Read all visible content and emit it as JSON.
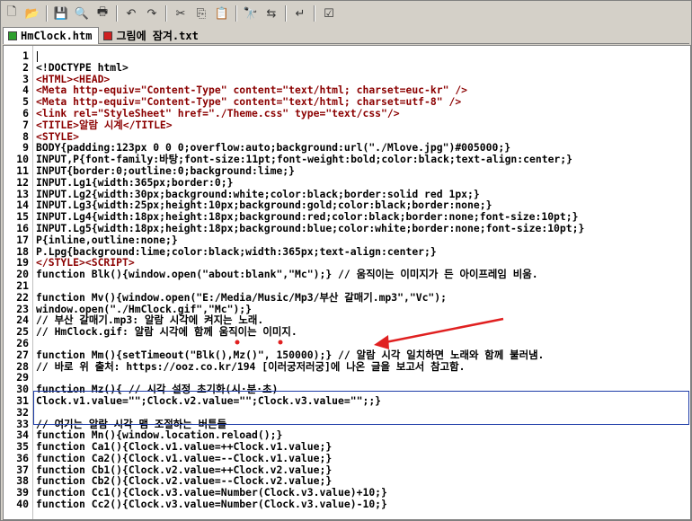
{
  "toolbar": {
    "buttons": [
      {
        "name": "new-file-icon",
        "glyph": "🗋"
      },
      {
        "name": "open-folder-icon",
        "glyph": "📂"
      },
      {
        "name": "save-icon",
        "glyph": "💾"
      },
      {
        "name": "print-preview-icon",
        "glyph": "🔍"
      },
      {
        "name": "print-icon",
        "glyph": "🖶"
      },
      {
        "name": "undo-icon",
        "glyph": "↶"
      },
      {
        "name": "redo-icon",
        "glyph": "↷"
      },
      {
        "name": "cut-icon",
        "glyph": "✂"
      },
      {
        "name": "copy-icon",
        "glyph": "⎘"
      },
      {
        "name": "paste-icon",
        "glyph": "📋"
      },
      {
        "name": "find-icon",
        "glyph": "🔭"
      },
      {
        "name": "replace-icon",
        "glyph": "⇆"
      },
      {
        "name": "word-wrap-icon",
        "glyph": "↵"
      },
      {
        "name": "checklist-icon",
        "glyph": "☑"
      }
    ]
  },
  "tabs": [
    {
      "label": "HmClock.htm",
      "color": "#2ea02e",
      "active": true
    },
    {
      "label": "그림에 잠겨.txt",
      "color": "#d02020",
      "active": false
    }
  ],
  "editor": {
    "lines": [
      {
        "n": "1",
        "text": ""
      },
      {
        "n": "2",
        "text": "<!DOCTYPE html>"
      },
      {
        "n": "3",
        "text": "<HTML><HEAD>"
      },
      {
        "n": "4",
        "text": "<Meta http-equiv=\"Content-Type\" content=\"text/html; charset=euc-kr\" />"
      },
      {
        "n": "5",
        "text": "<Meta http-equiv=\"Content-Type\" content=\"text/html; charset=utf-8\" />"
      },
      {
        "n": "6",
        "text": "<link rel=\"StyleSheet\" href=\"./Theme.css\" type=\"text/css\"/>"
      },
      {
        "n": "7",
        "text": "<TITLE>알람 시계</TITLE>"
      },
      {
        "n": "8",
        "text": "<STYLE>"
      },
      {
        "n": "9",
        "text": "BODY{padding:123px 0 0 0;overflow:auto;background:url(\"./Mlove.jpg\")#005000;}"
      },
      {
        "n": "10",
        "text": "INPUT,P{font-family:바탕;font-size:11pt;font-weight:bold;color:black;text-align:center;}"
      },
      {
        "n": "11",
        "text": "INPUT{border:0;outline:0;background:lime;}"
      },
      {
        "n": "12",
        "text": "INPUT.Lg1{width:365px;border:0;}"
      },
      {
        "n": "13",
        "text": "INPUT.Lg2{width:30px;background:white;color:black;border:solid red 1px;}"
      },
      {
        "n": "14",
        "text": "INPUT.Lg3{width:25px;height:10px;background:gold;color:black;border:none;}"
      },
      {
        "n": "15",
        "text": "INPUT.Lg4{width:18px;height:18px;background:red;color:black;border:none;font-size:10pt;}"
      },
      {
        "n": "16",
        "text": "INPUT.Lg5{width:18px;height:18px;background:blue;color:white;border:none;font-size:10pt;}"
      },
      {
        "n": "17",
        "text": "P{inline,outline:none;}"
      },
      {
        "n": "18",
        "text": "P.Lpg{background:lime;color:black;width:365px;text-align:center;}"
      },
      {
        "n": "19",
        "text": "</STYLE><SCRIPT>"
      },
      {
        "n": "20",
        "text": "function Blk(){window.open(\"about:blank\",\"Mc\");} // 움직이는 이미지가 든 아이프레임 비움."
      },
      {
        "n": "21",
        "text": ""
      },
      {
        "n": "22",
        "text": "function Mv(){window.open(\"E:/Media/Music/Mp3/부산 갈매기.mp3\",\"Vc\");"
      },
      {
        "n": "23",
        "text": "window.open(\"./HmClock.gif\",\"Mc\");}"
      },
      {
        "n": "24",
        "text": "// 부산 갈매기.mp3: 알람 시각에 켜지는 노래."
      },
      {
        "n": "25",
        "text": "// HmClock.gif: 알람 시각에 함께 움직이는 이미지."
      },
      {
        "n": "26",
        "text": ""
      },
      {
        "n": "27",
        "text": "function Mm(){setTimeout(\"Blk(),Mz()\", 150000);} // 알람 시각 일치하면 노래와 함께 불러냄."
      },
      {
        "n": "28",
        "text": "// 바로 위 출처: https://ooz.co.kr/194 [이러궁저러궁]에 나온 글을 보고서 참고함."
      },
      {
        "n": "29",
        "text": ""
      },
      {
        "n": "30",
        "text": "function Mz(){ // 시각 설정 초기화(시·분·초)"
      },
      {
        "n": "31",
        "text": "Clock.v1.value=\"\";Clock.v2.value=\"\";Clock.v3.value=\"\";;}"
      },
      {
        "n": "32",
        "text": ""
      },
      {
        "n": "33",
        "text": "// 여기는 알람 시각 맴 조절하는 버튼들"
      },
      {
        "n": "34",
        "text": "function Mn(){window.location.reload();}"
      },
      {
        "n": "35",
        "text": "function Ca1(){Clock.v1.value=++Clock.v1.value;}"
      },
      {
        "n": "36",
        "text": "function Ca2(){Clock.v1.value=--Clock.v1.value;}"
      },
      {
        "n": "37",
        "text": "function Cb1(){Clock.v2.value=++Clock.v2.value;}"
      },
      {
        "n": "38",
        "text": "function Cb2(){Clock.v2.value=--Clock.v2.value;}"
      },
      {
        "n": "39",
        "text": "function Cc1(){Clock.v3.value=Number(Clock.v3.value)+10;}"
      },
      {
        "n": "40",
        "text": "function Cc2(){Clock.v3.value=Number(Clock.v3.value)-10;}"
      }
    ]
  },
  "annotation": {
    "arrow_color": "#e02020",
    "box_color": "#1e3ca8"
  }
}
